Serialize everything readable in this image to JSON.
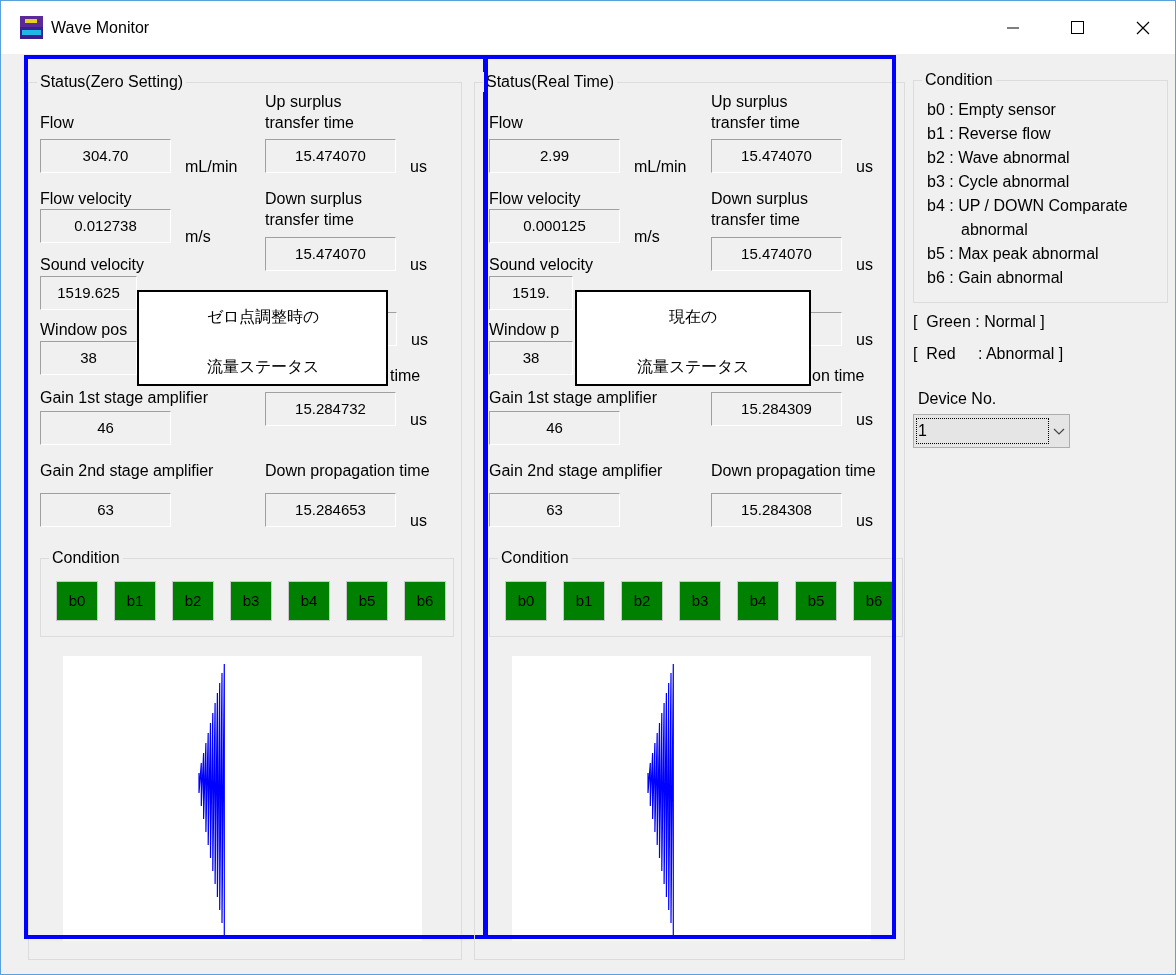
{
  "window": {
    "title": "Wave Monitor"
  },
  "panels": [
    {
      "title": "Status(Zero Setting)",
      "highlighted": true,
      "left_fields": [
        {
          "label": "Flow",
          "value": "304.70",
          "unit": "mL/min"
        },
        {
          "label": "Flow velocity",
          "value": "0.012738",
          "unit": "m/s"
        },
        {
          "label": "Sound velocity",
          "value": "1519.625"
        },
        {
          "label": "Window pos",
          "value": "38"
        },
        {
          "label": "Gain 1st stage amplifier",
          "value": "46"
        },
        {
          "label": "Gain 2nd stage amplifier",
          "value": "63"
        }
      ],
      "right_fields": [
        {
          "label": "Up surplus transfer time",
          "value": "15.474070",
          "unit": "us"
        },
        {
          "label": "Down surplus transfer time",
          "value": "15.474070",
          "unit": "us"
        },
        {
          "unit": "us"
        },
        {
          "label": "time",
          "value": "15.284732",
          "unit": "us"
        },
        {
          "label": "Down propagation time",
          "value": "15.284653",
          "unit": "us"
        }
      ],
      "condition": {
        "title": "Condition",
        "flags": [
          {
            "label": "b0",
            "color": "#008000"
          },
          {
            "label": "b1",
            "color": "#008000"
          },
          {
            "label": "b2",
            "color": "#008000"
          },
          {
            "label": "b3",
            "color": "#008000"
          },
          {
            "label": "b4",
            "color": "#008000"
          },
          {
            "label": "b5",
            "color": "#008000"
          },
          {
            "label": "b6",
            "color": "#008000"
          }
        ]
      },
      "callout": [
        "ゼロ点調整時の",
        "流量ステータス"
      ]
    },
    {
      "title": "Status(Real Time)",
      "highlighted": true,
      "left_fields": [
        {
          "label": "Flow",
          "value": "2.99",
          "unit": "mL/min"
        },
        {
          "label": "Flow velocity",
          "value": "0.000125",
          "unit": "m/s"
        },
        {
          "label": "Sound velocity",
          "value": "1519."
        },
        {
          "label": "Window p",
          "value": "38"
        },
        {
          "label": "Gain 1st stage amplifier",
          "value": "46"
        },
        {
          "label": "Gain 2nd stage amplifier",
          "value": "63"
        }
      ],
      "right_fields": [
        {
          "label": "Up surplus transfer time",
          "value": "15.474070",
          "unit": "us"
        },
        {
          "label": "Down surplus transfer time",
          "value": "15.474070",
          "unit": "us"
        },
        {
          "unit": "us"
        },
        {
          "label": "on time",
          "value": "15.284309",
          "unit": "us"
        },
        {
          "label": "Down propagation time",
          "value": "15.284308",
          "unit": "us"
        }
      ],
      "condition": {
        "title": "Condition",
        "flags": [
          {
            "label": "b0",
            "color": "#008000"
          },
          {
            "label": "b1",
            "color": "#008000"
          },
          {
            "label": "b2",
            "color": "#008000"
          },
          {
            "label": "b3",
            "color": "#008000"
          },
          {
            "label": "b4",
            "color": "#008000"
          },
          {
            "label": "b5",
            "color": "#008000"
          },
          {
            "label": "b6",
            "color": "#008000"
          }
        ]
      },
      "callout": [
        "現在の",
        "流量ステータス"
      ]
    }
  ],
  "legend": {
    "title": "Condition",
    "items": [
      "b0 : Empty sensor",
      "b1 : Reverse flow",
      "b2 : Wave abnormal",
      "b3 : Cycle abnormal",
      "b4 : UP / DOWN Comparate abnormal",
      "b5 : Max peak abnormal",
      "b6 : Gain abnormal"
    ],
    "notes": [
      "[  Green : Normal ]",
      "[  Red     : Abnormal ]"
    ]
  },
  "device": {
    "label": "Device No.",
    "value": "1"
  }
}
